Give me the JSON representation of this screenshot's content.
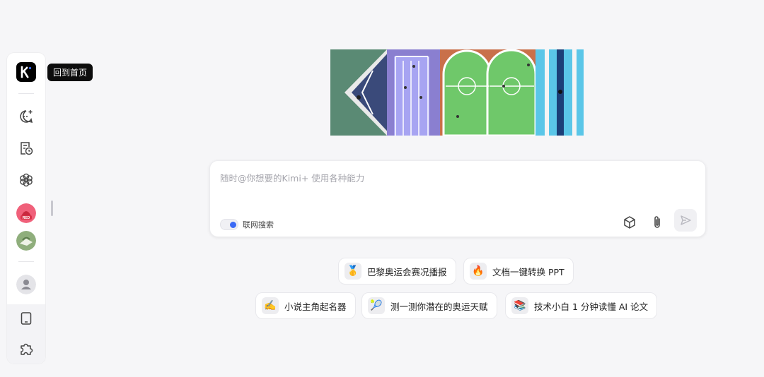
{
  "sidebar": {
    "tooltip": "回到首页",
    "items": [
      {
        "name": "new-chat-icon"
      },
      {
        "name": "history-icon"
      },
      {
        "name": "kimi-plus-icon"
      },
      {
        "name": "red-avatar",
        "badge": "RED"
      },
      {
        "name": "green-avatar"
      },
      {
        "name": "user-avatar"
      },
      {
        "name": "tablet-icon"
      },
      {
        "name": "plugin-icon"
      }
    ]
  },
  "chat": {
    "placeholder": "随时@你想要的Kimi+ 使用各种能力",
    "web_search_label": "联网搜索"
  },
  "suggestions": [
    {
      "emoji": "🥇",
      "label": "巴黎奥运会赛况播报"
    },
    {
      "emoji": "🔥",
      "label": "文档一键转换 PPT"
    },
    {
      "emoji": "✍️",
      "label": "小说主角起名器"
    },
    {
      "emoji": "🎾",
      "label": "测一测你潜在的奥运天赋"
    },
    {
      "emoji": "📚",
      "label": "技术小白 1 分钟读懂 AI 论文"
    }
  ],
  "colors": {
    "accent": "#3b6af5",
    "background": "#f6f6f8"
  }
}
